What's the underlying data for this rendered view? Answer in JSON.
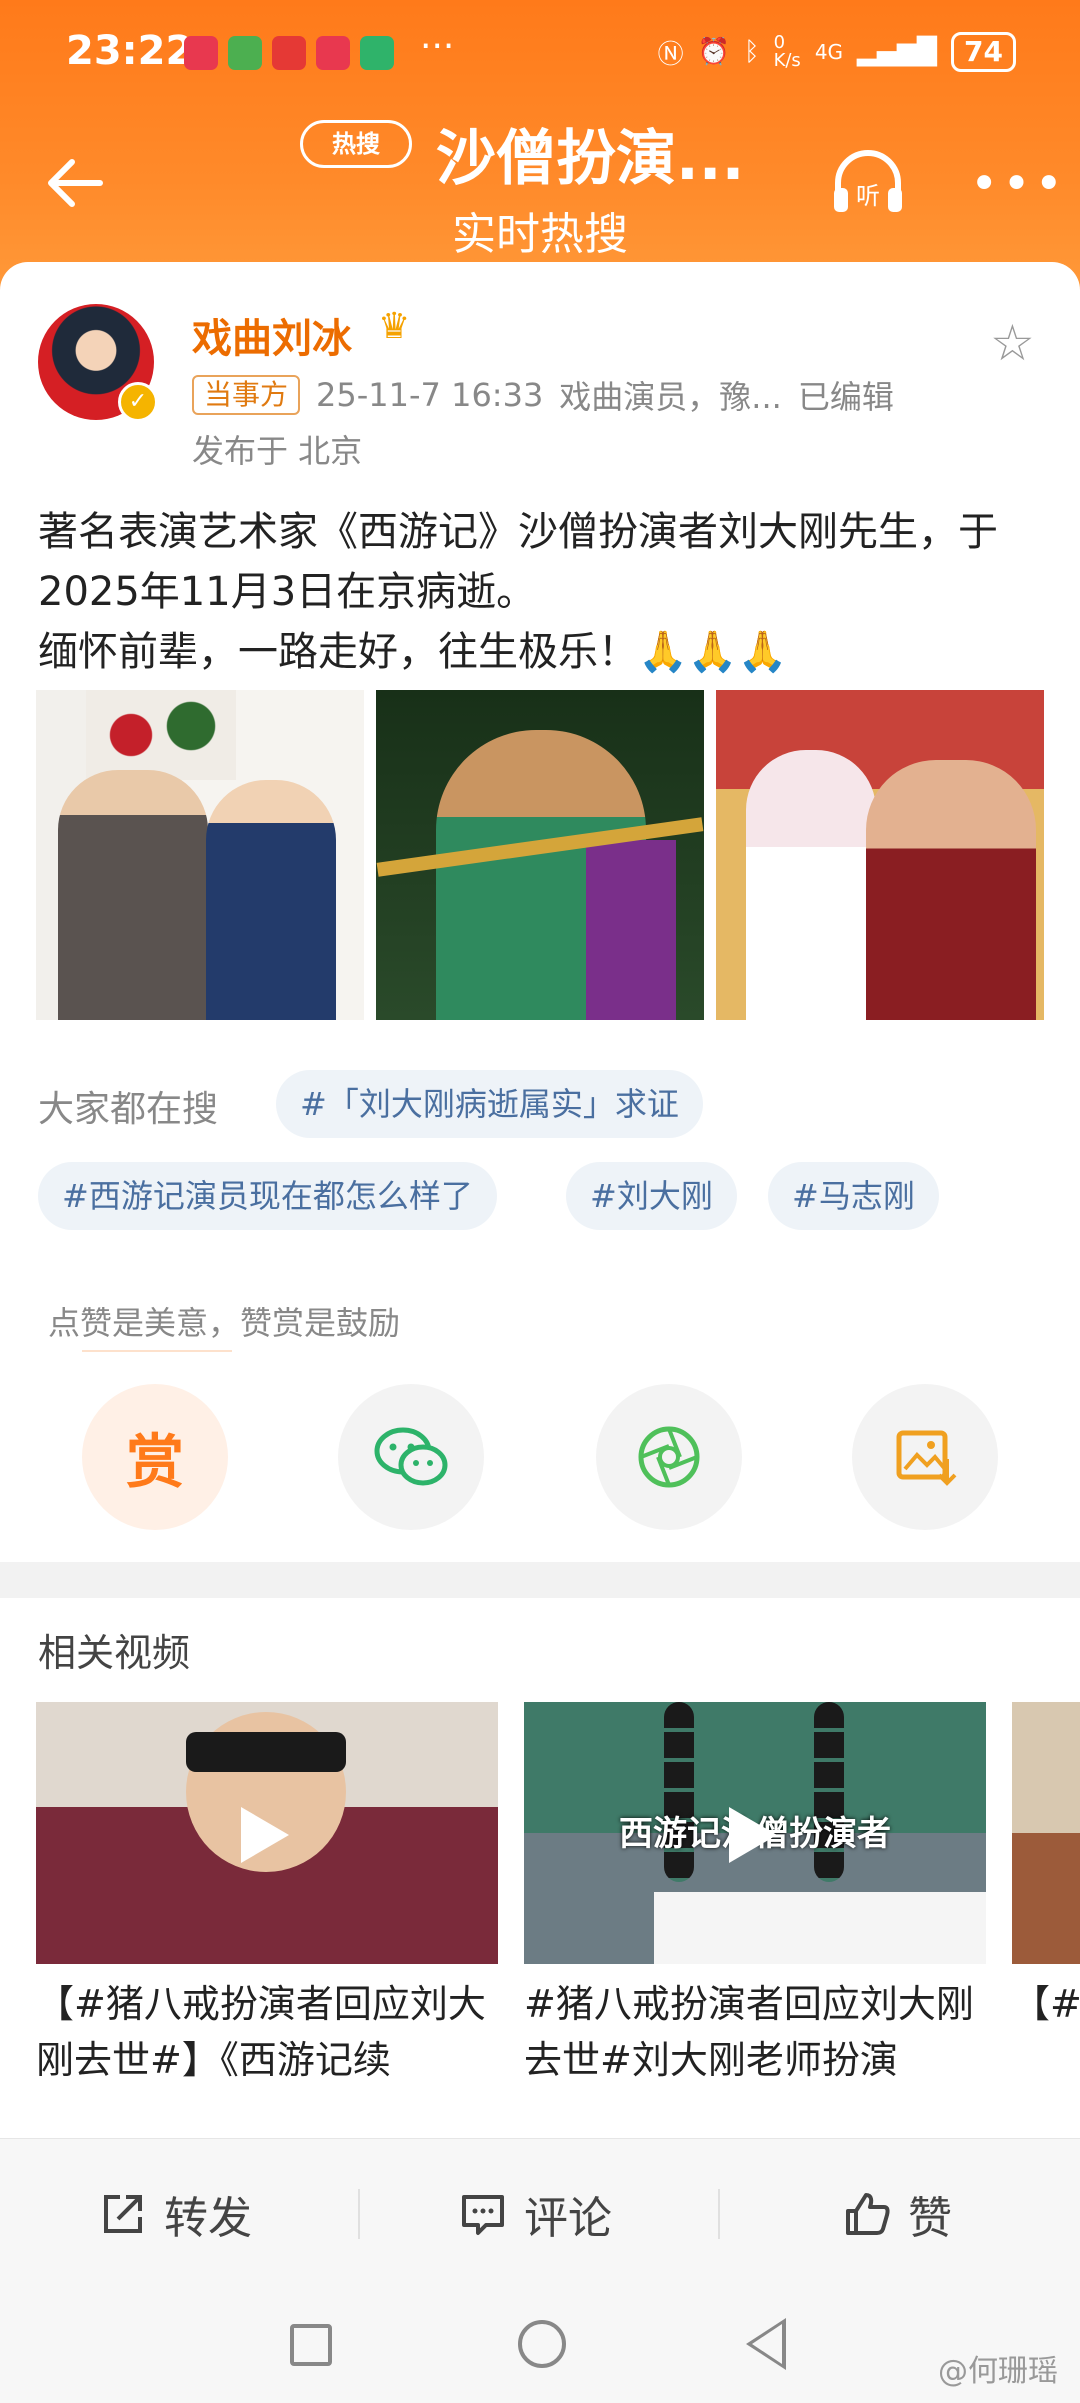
{
  "status_bar": {
    "time": "23:22",
    "more_indicator": "···",
    "network_speed": "0\nK/s",
    "network": "4G",
    "battery": "74"
  },
  "nav": {
    "hot_badge": "热搜",
    "title": "沙僧扮演...",
    "subtitle": "实时热搜",
    "listen_label": "听",
    "more": "•••"
  },
  "post": {
    "username": "戏曲刘冰",
    "tag": "当事方",
    "datetime": "25-11-7 16:33",
    "profession": "戏曲演员，豫...",
    "edited": "已编辑",
    "location": "发布于 北京",
    "text": "著名表演艺术家《西游记》沙僧扮演者刘大刚先生，于2025年11月3日在京病逝。\n缅怀前辈，一路走好，往生极乐！🙏🙏🙏"
  },
  "search_section": {
    "label": "大家都在搜",
    "chips": [
      "#「刘大刚病逝属实」求证",
      "#西游记演员现在都怎么样了",
      "#刘大刚",
      "#马志刚"
    ]
  },
  "reward": {
    "hint": "点赞是美意，赞赏是鼓励",
    "reward_label": "赏"
  },
  "related": {
    "title": "相关视频",
    "videos": [
      {
        "title": "【#猪八戒扮演者回应刘大刚去世#】《西游记续"
      },
      {
        "title": "#猪八戒扮演者回应刘大刚去世#刘大刚老师扮演",
        "overlay": "西游记沙僧扮演者"
      },
      {
        "title": "【#寺#"
      }
    ]
  },
  "bottom_bar": {
    "repost": "转发",
    "comment": "评论",
    "like": "赞"
  },
  "watermark": "@何珊瑶",
  "colors": {
    "header": "#ff7a1a",
    "username": "#ec6c00",
    "chip_text": "#4a6fa0"
  }
}
